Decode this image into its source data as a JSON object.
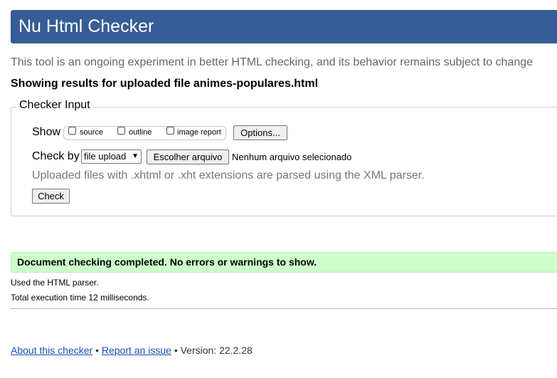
{
  "header": {
    "title": "Nu Html Checker"
  },
  "tagline": "This tool is an ongoing experiment in better HTML checking, and its behavior remains subject to change",
  "showing_results": "Showing results for uploaded file animes-populares.html",
  "checker_input": {
    "legend": "Checker Input",
    "show_label": "Show",
    "show_options": [
      {
        "label": "source",
        "checked": false
      },
      {
        "label": "outline",
        "checked": false
      },
      {
        "label": "image report",
        "checked": false
      }
    ],
    "options_button": "Options...",
    "check_by_label": "Check by",
    "check_by_value": "file upload",
    "choose_file_button": "Escolher arquivo",
    "no_file_text": "Nenhum arquivo selecionado",
    "note": "Uploaded files with .xhtml or .xht extensions are parsed using the XML parser.",
    "check_button": "Check"
  },
  "result": {
    "message": "Document checking completed. No errors or warnings to show.",
    "parser_info": "Used the HTML parser.",
    "execution_time": "Total execution time 12 milliseconds."
  },
  "footer": {
    "about_link": "About this checker",
    "separator": "•",
    "report_link": "Report an issue",
    "version": "Version: 22.2.28"
  },
  "colors": {
    "header_bg": "#365d95",
    "success_bg": "#ccffcc",
    "link": "#1a4fb6"
  }
}
